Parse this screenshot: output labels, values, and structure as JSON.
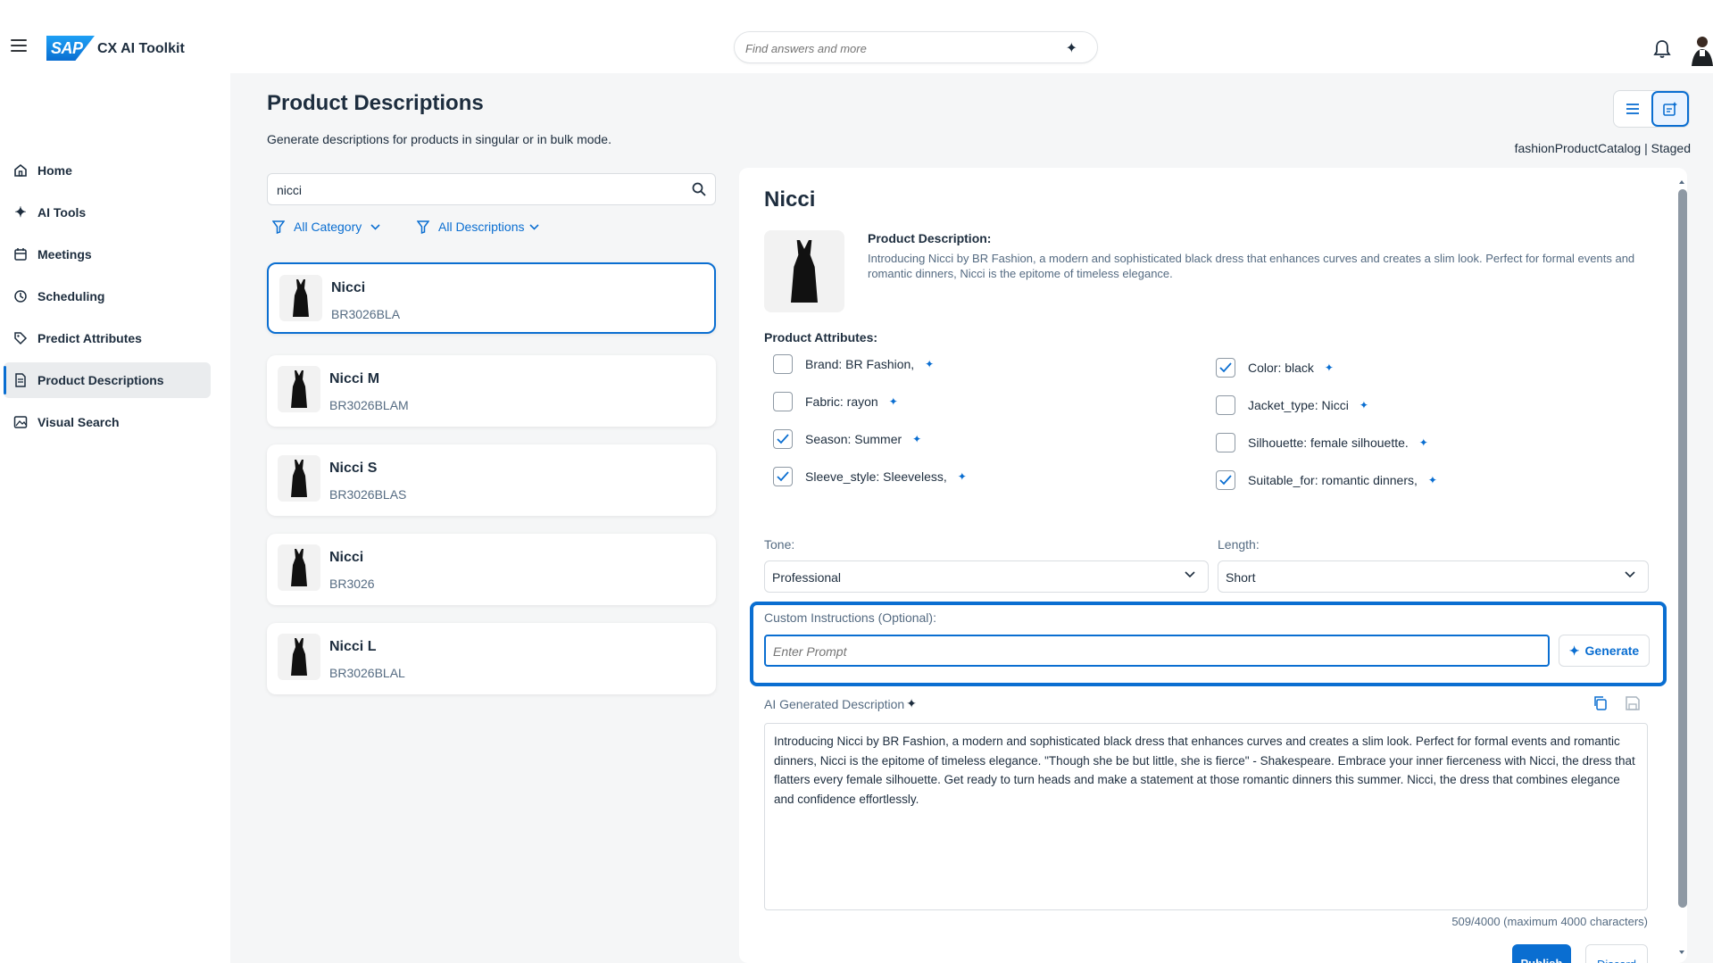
{
  "header": {
    "app_title": "CX AI Toolkit",
    "logo_text": "SAP",
    "search_placeholder": "Find answers and more"
  },
  "sidebar": {
    "items": [
      {
        "label": "Home",
        "icon": "home-icon"
      },
      {
        "label": "AI Tools",
        "icon": "sparkle-icon"
      },
      {
        "label": "Meetings",
        "icon": "calendar-icon"
      },
      {
        "label": "Scheduling",
        "icon": "scheduling-icon"
      },
      {
        "label": "Predict Attributes",
        "icon": "tag-icon"
      },
      {
        "label": "Product Descriptions",
        "icon": "document-icon",
        "active": true
      },
      {
        "label": "Visual Search",
        "icon": "image-search-icon"
      }
    ]
  },
  "page": {
    "title": "Product Descriptions",
    "subtitle": "Generate descriptions for products in singular or in bulk mode.",
    "catalog": "fashionProductCatalog | Staged"
  },
  "search": {
    "value": "nicci"
  },
  "filters": {
    "category": "All Category",
    "descriptions": "All Descriptions"
  },
  "products": [
    {
      "name": "Nicci",
      "code": "BR3026BLA",
      "selected": true
    },
    {
      "name": "Nicci M",
      "code": "BR3026BLAM"
    },
    {
      "name": "Nicci S",
      "code": "BR3026BLAS"
    },
    {
      "name": "Nicci",
      "code": "BR3026"
    },
    {
      "name": "Nicci L",
      "code": "BR3026BLAL"
    }
  ],
  "detail": {
    "title": "Nicci",
    "description_label": "Product Description:",
    "description": "Introducing Nicci by BR Fashion, a modern and sophisticated black dress that enhances curves and creates a slim look. Perfect for formal events and romantic dinners, Nicci is the epitome of timeless elegance.",
    "attributes_label": "Product Attributes:",
    "attributes": [
      {
        "label": "Brand: BR Fashion,",
        "checked": false
      },
      {
        "label": "Fabric: rayon",
        "checked": false
      },
      {
        "label": "Season: Summer",
        "checked": true
      },
      {
        "label": "Sleeve_style: Sleeveless,",
        "checked": true
      },
      {
        "label": "Color: black",
        "checked": true
      },
      {
        "label": "Jacket_type: Nicci",
        "checked": false
      },
      {
        "label": "Silhouette: female silhouette.",
        "checked": false
      },
      {
        "label": "Suitable_for: romantic dinners,",
        "checked": true
      }
    ],
    "tone_label": "Tone:",
    "tone_value": "Professional",
    "length_label": "Length:",
    "length_value": "Short",
    "custom_label": "Custom Instructions (Optional):",
    "custom_placeholder": "Enter Prompt",
    "generate_label": "Generate",
    "ai_label": "AI Generated Description",
    "ai_text": "Introducing Nicci by BR Fashion, a modern and sophisticated black dress that enhances curves and creates a slim look. Perfect for formal events and romantic dinners, Nicci is the epitome of timeless elegance. \"Though she be but little, she is fierce\" - Shakespeare. Embrace your inner fierceness with Nicci, the dress that flatters every female silhouette. Get ready to turn heads and make a statement at those romantic dinners this summer. Nicci, the dress that combines elegance and confidence effortlessly.",
    "counter": "509/4000 (maximum 4000 characters)",
    "publish_label": "Publish",
    "discard_label": "Discard"
  },
  "colors": {
    "accent": "#0a6ed1",
    "text": "#1d2d3e",
    "muted": "#556b82",
    "background": "#f5f6f7"
  }
}
